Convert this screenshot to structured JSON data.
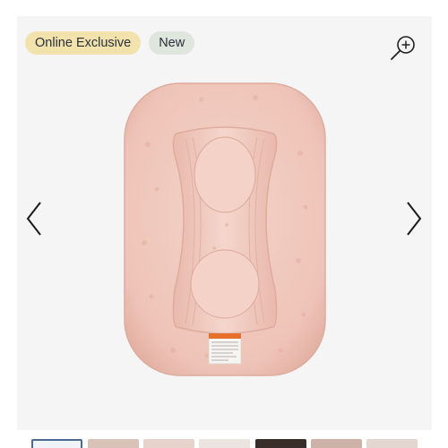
{
  "badges": {
    "online_exclusive": "Online Exclusive",
    "new": "New"
  },
  "controls": {
    "zoom_icon": "zoom-in-icon",
    "prev_icon": "chevron-left-icon",
    "next_icon": "chevron-right-icon"
  },
  "product": {
    "image": "pink-floral-baby-lounger",
    "label_icon": "warning-label-icon"
  },
  "colors": {
    "gallery_bg": "#f5f5f5",
    "lounger": "#f0c9bd",
    "badge_online": "#f2e3ad",
    "badge_new": "#dfe6de",
    "active_thumb_border": "#4a6b90"
  }
}
